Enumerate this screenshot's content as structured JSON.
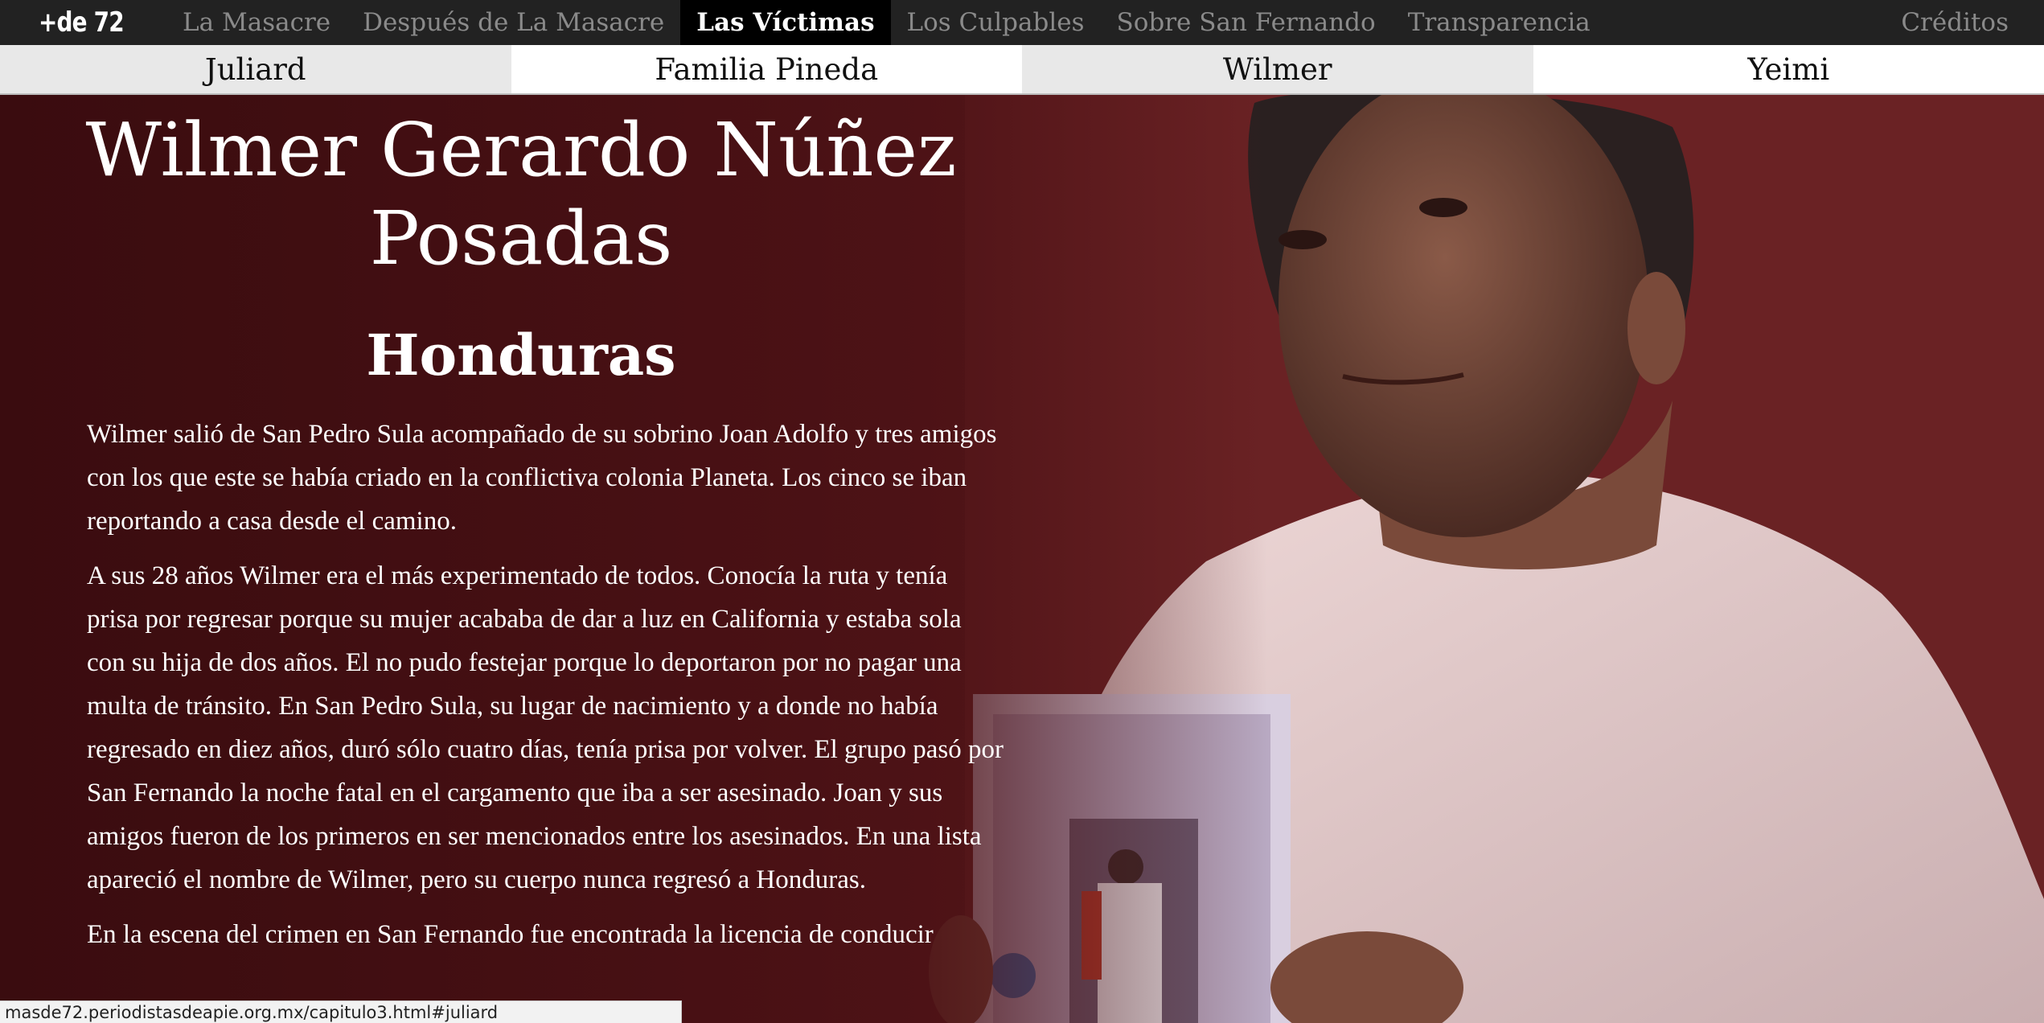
{
  "nav": {
    "logo": "+de 72",
    "items": [
      {
        "label": "La Masacre",
        "active": false
      },
      {
        "label": "Después de La Masacre",
        "active": false
      },
      {
        "label": "Las Víctimas",
        "active": true
      },
      {
        "label": "Los Culpables",
        "active": false
      },
      {
        "label": "Sobre San Fernando",
        "active": false
      },
      {
        "label": "Transparencia",
        "active": false
      }
    ],
    "credits": "Créditos"
  },
  "tabs": [
    {
      "label": "Juliard"
    },
    {
      "label": "Familia Pineda"
    },
    {
      "label": "Wilmer"
    },
    {
      "label": "Yeimi"
    }
  ],
  "victim": {
    "name_line1": "Wilmer Gerardo Núñez",
    "name_line2": "Posadas",
    "country": "Honduras",
    "paragraphs": [
      "Wilmer salió de San Pedro Sula acompañado de su sobrino Joan Adolfo y tres amigos con los que este se había criado en la conflictiva colonia Planeta. Los cinco se iban reportando a casa desde el camino.",
      "A sus 28 años Wilmer era el más experimentado de todos. Conocía la ruta y tenía prisa por regresar porque su mujer acababa de dar a luz en California y estaba sola con su hija de dos años. El no pudo festejar porque lo deportaron por no pagar una multa de tránsito. En San Pedro Sula, su lugar de nacimiento y a donde no había regresado en diez años, duró sólo cuatro días, tenía prisa por volver. El grupo pasó por San Fernando la noche fatal en el cargamento que iba a ser asesinado. Joan y sus amigos fueron de los primeros en ser mencionados entre los asesinados. En una lista apareció el nombre de Wilmer, pero su cuerpo nunca regresó a Honduras.",
      "En la escena del crimen en San Fernando fue encontrada la licencia de conducir"
    ]
  },
  "status_url": "masde72.periodistasdeapie.org.mx/capitulo3.html#juliard",
  "colors": {
    "nav_bg": "#222222",
    "nav_active_bg": "#000000",
    "hero_bg": "#4b1115"
  }
}
